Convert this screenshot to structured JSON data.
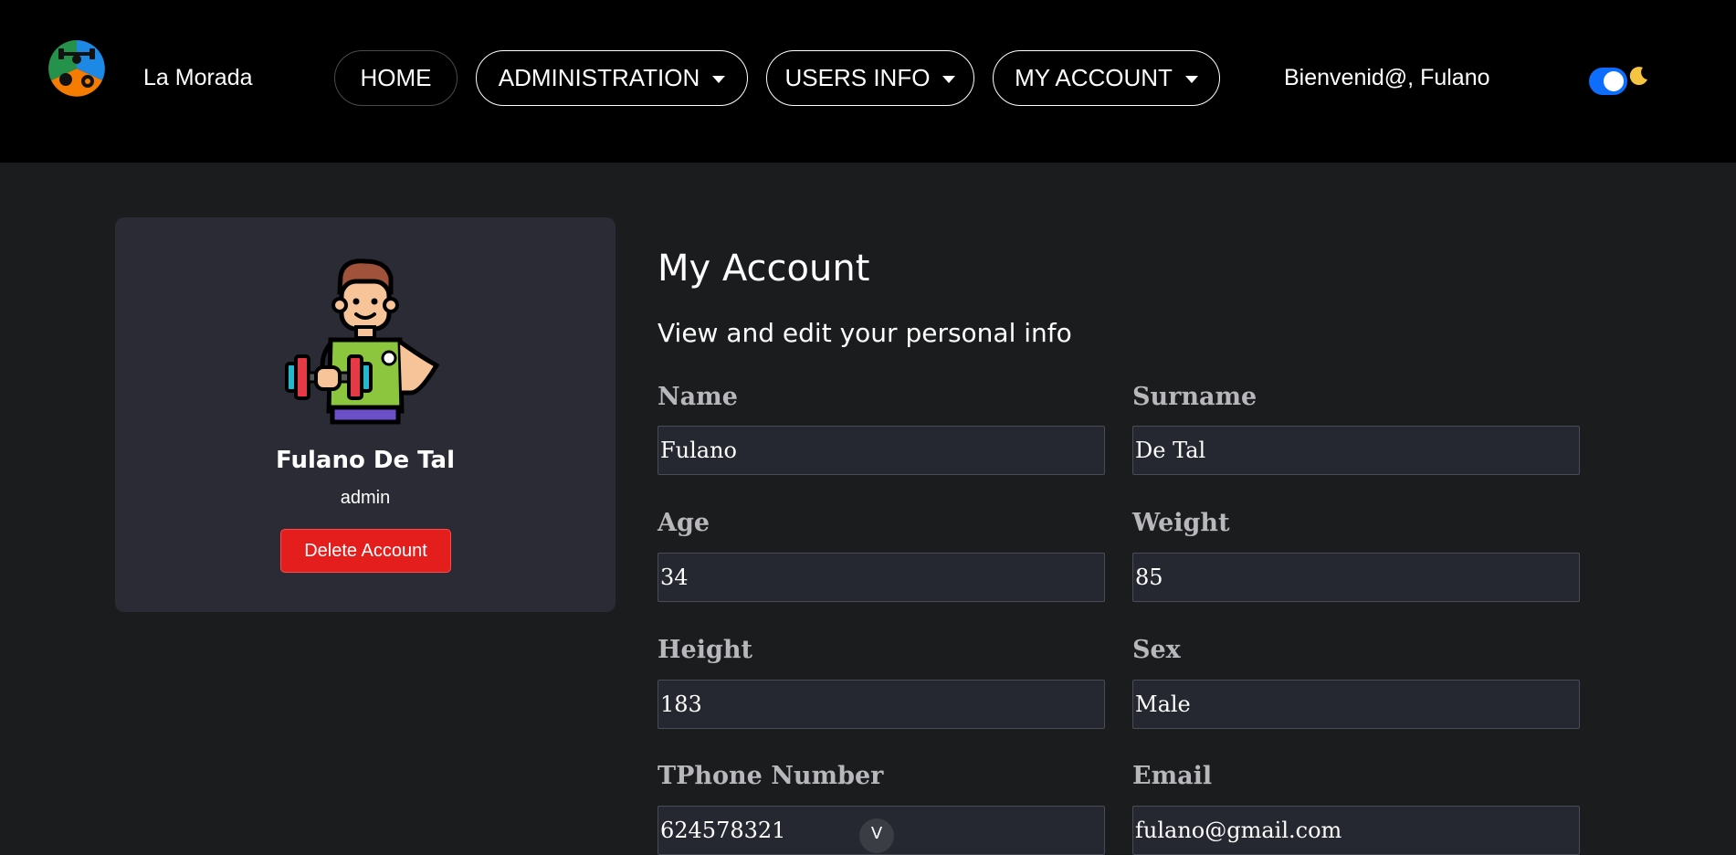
{
  "header": {
    "brand": "La Morada",
    "nav": {
      "home": "HOME",
      "administration": "ADMINISTRATION",
      "users_info": "USERS INFO",
      "my_account": "MY ACCOUNT"
    },
    "welcome": "Bienvenid@, Fulano",
    "theme_toggle_on": true,
    "icons": {
      "logo": "gym-logo-icon",
      "toggle_mode": "moon-icon"
    }
  },
  "profile": {
    "name": "Fulano De Tal",
    "role": "admin",
    "delete_label": "Delete Account",
    "avatar_icon": "athlete-avatar-icon"
  },
  "account": {
    "title": "My Account",
    "subtitle": "View and edit your personal info",
    "fields": {
      "name": {
        "label": "Name",
        "value": "Fulano"
      },
      "surname": {
        "label": "Surname",
        "value": "De Tal"
      },
      "age": {
        "label": "Age",
        "value": "34"
      },
      "weight": {
        "label": "Weight",
        "value": "85"
      },
      "height": {
        "label": "Height",
        "value": "183"
      },
      "sex": {
        "label": "Sex",
        "value": "Male"
      },
      "phone": {
        "label": "TPhone Number",
        "value": "624578321"
      },
      "email": {
        "label": "Email",
        "value": "fulano@gmail.com"
      }
    }
  },
  "scroll_indicator": "V",
  "colors": {
    "header_bg": "#000000",
    "page_bg": "#1b1c1e",
    "card_bg": "#2b2b35",
    "danger": "#e41d1d",
    "toggle": "#0d6efd"
  }
}
